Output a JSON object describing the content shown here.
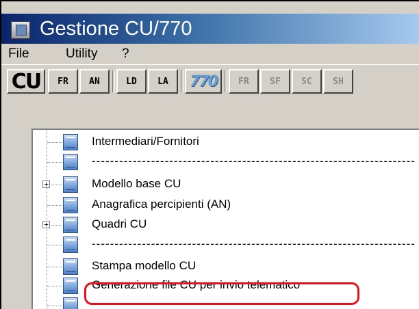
{
  "window": {
    "title": "Gestione CU/770"
  },
  "menu": {
    "items": [
      "File",
      "Utility",
      "?"
    ]
  },
  "toolbar": {
    "cu": "CU",
    "fr1": "FR",
    "an": "AN",
    "ld": "LD",
    "la": "LA",
    "logo770": "770",
    "fr2": "FR",
    "sf": "SF",
    "sc": "SC",
    "sh": "SH"
  },
  "tree": {
    "items": [
      {
        "label": "Intermediari/Fornitori",
        "expandable": false
      },
      {
        "label": "-----------------------------------------------------------------------",
        "expandable": false
      },
      {
        "label": "Modello base CU",
        "expandable": true
      },
      {
        "label": "Anagrafica percipienti (AN)",
        "expandable": false
      },
      {
        "label": "Quadri CU",
        "expandable": true
      },
      {
        "label": "-----------------------------------------------------------------------",
        "expandable": false
      },
      {
        "label": "Stampa modello CU",
        "expandable": false
      },
      {
        "label": "Generazione file CU per invio telematico",
        "expandable": false,
        "highlighted": true
      }
    ],
    "expander_symbol": "+"
  },
  "colors": {
    "highlight": "#e8101c",
    "title_gradient_start": "#0a246a",
    "title_gradient_end": "#a6caf0"
  }
}
